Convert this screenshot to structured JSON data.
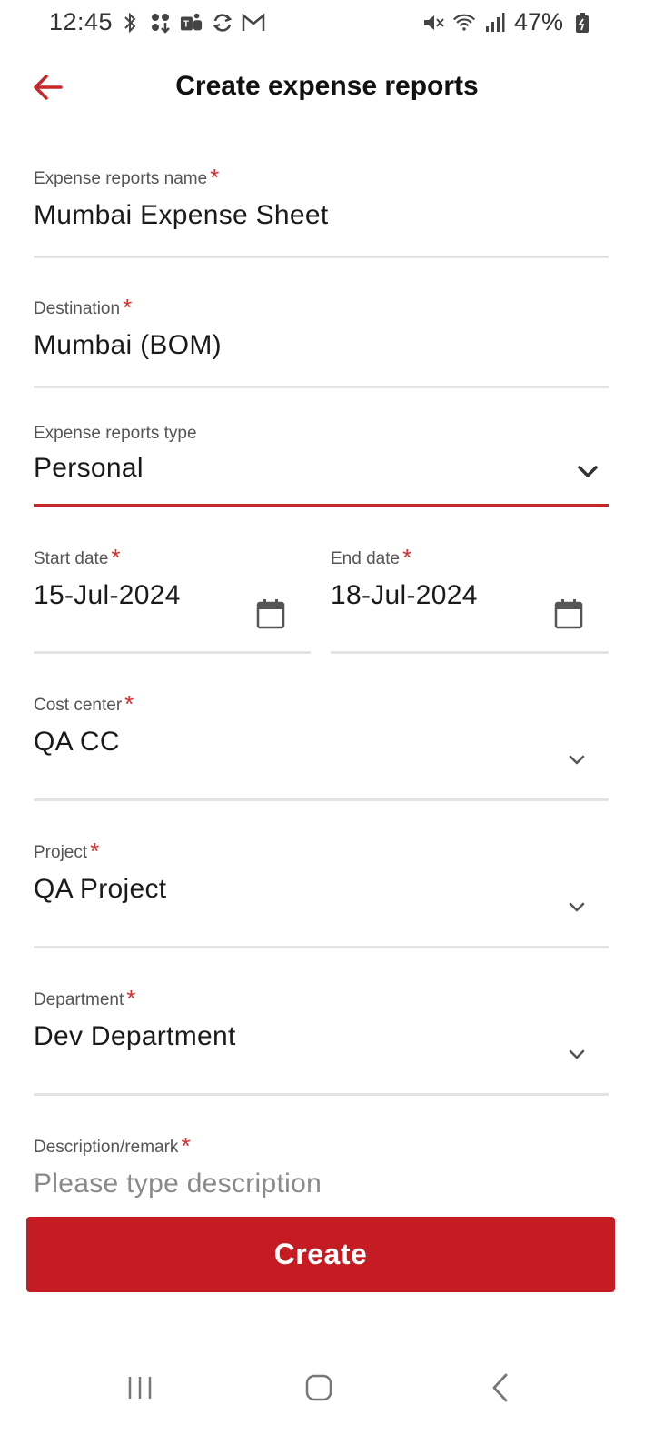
{
  "status_bar": {
    "time": "12:45",
    "battery_percent": "47%",
    "left_icons": [
      "bluetooth-icon",
      "apps-icon",
      "teams-icon",
      "sync-icon",
      "gmail-icon"
    ],
    "right_icons": [
      "mute-icon",
      "wifi-icon",
      "signal-icon",
      "battery-icon"
    ]
  },
  "header": {
    "title": "Create expense reports",
    "back_icon": "arrow-left-icon"
  },
  "form": {
    "name": {
      "label": "Expense reports name",
      "required": "*",
      "value": "Mumbai Expense Sheet"
    },
    "destination": {
      "label": "Destination",
      "required": "*",
      "value": "Mumbai (BOM)"
    },
    "type": {
      "label": "Expense reports type",
      "value": "Personal"
    },
    "start_date": {
      "label": "Start date",
      "required": "*",
      "value": "15-Jul-2024"
    },
    "end_date": {
      "label": "End date",
      "required": "*",
      "value": "18-Jul-2024"
    },
    "cost_center": {
      "label": "Cost center",
      "required": "*",
      "value": "QA CC"
    },
    "project": {
      "label": "Project",
      "required": "*",
      "value": "QA Project"
    },
    "department": {
      "label": "Department",
      "required": "*",
      "value": "Dev Department"
    },
    "description": {
      "label": "Description/remark",
      "required": "*",
      "placeholder": "Please type description"
    }
  },
  "actions": {
    "create_label": "Create"
  },
  "nav": {
    "recents_icon": "recents-icon",
    "home_icon": "home-icon",
    "back_icon": "back-chevron-icon"
  },
  "colors": {
    "accent": "#c41c22",
    "required": "#d32f2f",
    "active_underline": "#c62828"
  }
}
